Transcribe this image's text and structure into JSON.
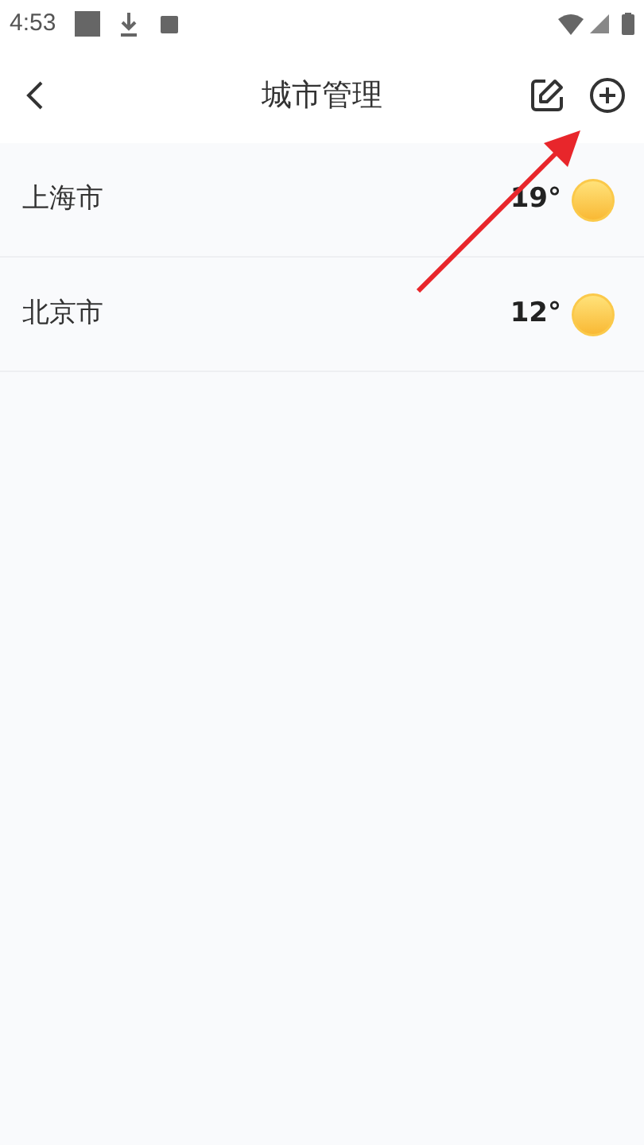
{
  "status_bar": {
    "time": "4:53"
  },
  "header": {
    "title": "城市管理"
  },
  "cities": [
    {
      "name": "上海市",
      "temperature": "19°",
      "kind": "sunny"
    },
    {
      "name": "北京市",
      "temperature": "12°",
      "kind": "sunny"
    }
  ]
}
